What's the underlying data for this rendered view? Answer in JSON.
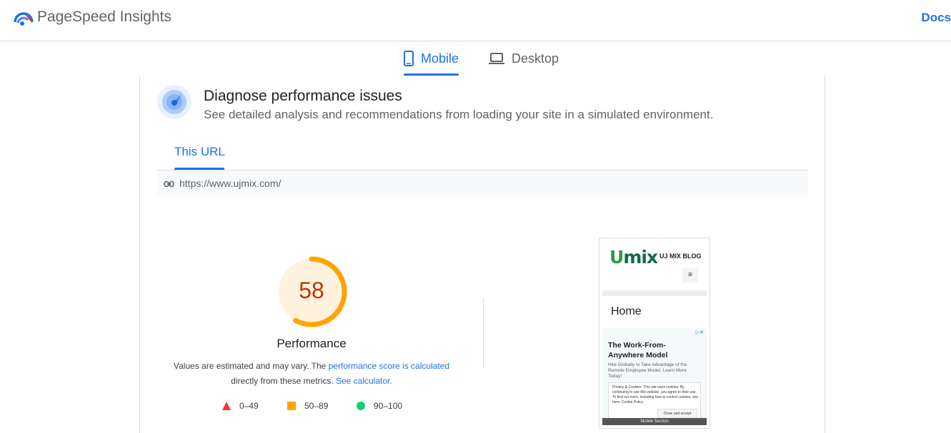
{
  "header": {
    "brand": "PageSpeed Insights",
    "docs_label": "Docs"
  },
  "device_tabs": [
    {
      "label": "Mobile",
      "active": true
    },
    {
      "label": "Desktop",
      "active": false
    }
  ],
  "diagnose": {
    "title": "Diagnose performance issues",
    "subtitle": "See detailed analysis and recommendations from loading your site in a simulated environment."
  },
  "url_tab": {
    "label": "This URL",
    "url": "https://www.ujmix.com/"
  },
  "performance": {
    "score": "58",
    "score_fraction": 0.58,
    "label": "Performance",
    "note_prefix": "Values are estimated and may vary. The ",
    "note_link1": "performance score is calculated",
    "note_mid": " directly from these metrics. ",
    "note_link2": "See calculator.",
    "colors": {
      "score_text": "#c33300",
      "arc": "#ffa400",
      "bg": "#fff3e0"
    }
  },
  "legend": [
    {
      "range": "0–49",
      "shape": "triangle",
      "color": "#ff3333"
    },
    {
      "range": "50–89",
      "shape": "square",
      "color": "#ffa400"
    },
    {
      "range": "90–100",
      "shape": "circle",
      "color": "#0cce6b"
    }
  ],
  "thumbnail": {
    "logo_u": "U",
    "logo_rest": "mix",
    "blog_title": "UJ MIX BLOG",
    "menu_glyph": "≡",
    "home": "Home",
    "ad_title": "The Work-From-Anywhere Model",
    "ad_body": "Hire Globally to Take Advantage of the Remote Employee Model. Learn More Today!",
    "cookie_text": "Privacy & Cookies: This site uses cookies. By continuing to use this website, you agree to their use. To find out more, including how to control cookies, see here: Cookie Policy",
    "cookie_button": "Close and accept",
    "footer": "Mobile Section",
    "ad_marker": "▷✕"
  }
}
